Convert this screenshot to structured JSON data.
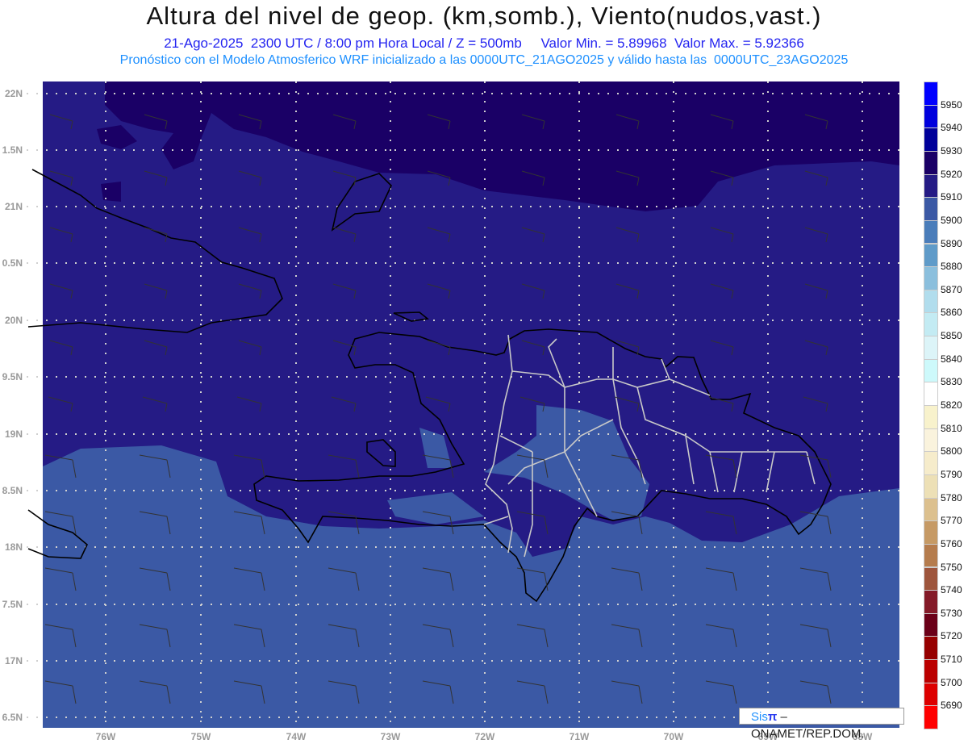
{
  "header": {
    "title": "Altura del nivel de geop. (km,somb.), Viento(nudos,vast.)",
    "subtitle": "21-Ago-2025  2300 UTC / 8:00 pm Hora Local / Z = 500mb     Valor Min. = 5.89968  Valor Max. = 5.92366",
    "info": "Pronóstico con el Modelo Atmosferico WRF inicializado a las 0000UTC_21AGO2025 y válido hasta las  0000UTC_23AGO2025"
  },
  "axes": {
    "lat_labels": [
      "22N",
      "1.5N",
      "21N",
      "0.5N",
      "20N",
      "9.5N",
      "19N",
      "8.5N",
      "18N",
      "7.5N",
      "17N",
      "6.5N"
    ],
    "lon_labels": [
      "76W",
      "75W",
      "74W",
      "73W",
      "72W",
      "71W",
      "70W",
      "69W",
      "68W"
    ]
  },
  "colorbar": {
    "labels": [
      "5950",
      "5940",
      "5930",
      "5920",
      "5910",
      "5900",
      "5890",
      "5880",
      "5870",
      "5860",
      "5850",
      "5840",
      "5830",
      "5820",
      "5810",
      "5800",
      "5790",
      "5780",
      "5770",
      "5760",
      "5750",
      "5740",
      "5730",
      "5720",
      "5710",
      "5700",
      "5690"
    ],
    "colors": [
      "#0000ff",
      "#0000dd",
      "#00009a",
      "#1a0066",
      "#251b85",
      "#3b59a5",
      "#4a7dba",
      "#5f9bc9",
      "#8bbfdd",
      "#b1dded",
      "#c3ebf3",
      "#dcf4f8",
      "#cdf9fb",
      "#ffffff",
      "#f8f2cc",
      "#faf3dd",
      "#f6eccb",
      "#ede0b6",
      "#dcc08e",
      "#c69a65",
      "#b57c4d",
      "#9e553c",
      "#841a28",
      "#6b0018",
      "#960000",
      "#bb0000",
      "#dd0000",
      "#ff0000"
    ]
  },
  "map_colors": {
    "dark": "#1a0066",
    "mid": "#251b85",
    "light": "#3b59a5"
  },
  "logo": {
    "sis": "Sis",
    "pi": "π",
    "text": " –  ONAMET/REP.DOM."
  }
}
